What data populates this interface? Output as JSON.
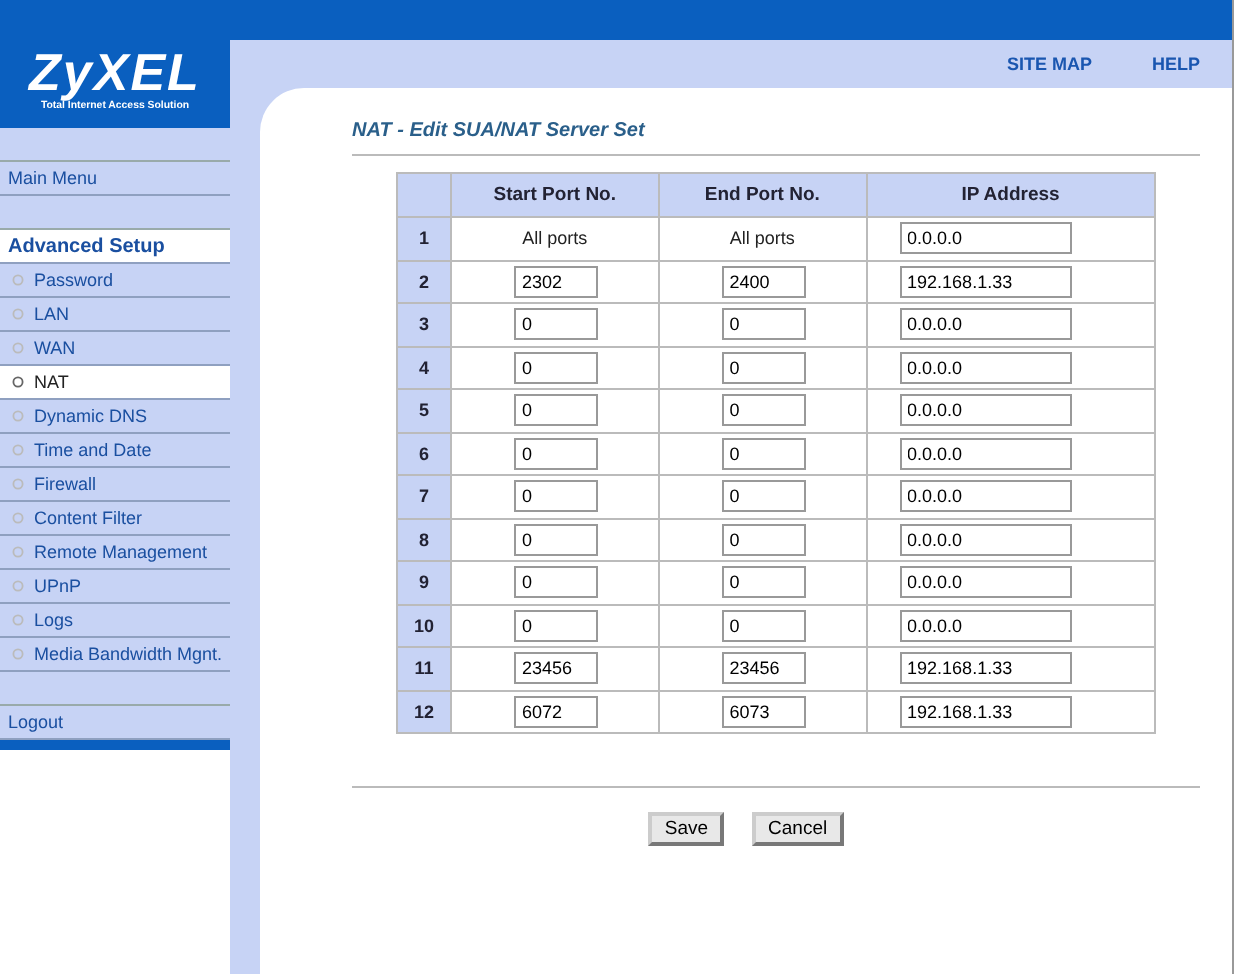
{
  "logo": {
    "name": "ZyXEL",
    "tagline": "Total Internet Access Solution"
  },
  "header_links": [
    "SITE MAP",
    "HELP"
  ],
  "sidebar": {
    "main_menu": "Main Menu",
    "section_title": "Advanced Setup",
    "items": [
      {
        "label": "Password",
        "selected": false
      },
      {
        "label": "LAN",
        "selected": false
      },
      {
        "label": "WAN",
        "selected": false
      },
      {
        "label": "NAT",
        "selected": true
      },
      {
        "label": "Dynamic DNS",
        "selected": false
      },
      {
        "label": "Time and Date",
        "selected": false
      },
      {
        "label": "Firewall",
        "selected": false
      },
      {
        "label": "Content Filter",
        "selected": false
      },
      {
        "label": "Remote Management",
        "selected": false
      },
      {
        "label": "UPnP",
        "selected": false
      },
      {
        "label": "Logs",
        "selected": false
      },
      {
        "label": "Media Bandwidth Mgnt.",
        "selected": false
      }
    ],
    "logout": "Logout"
  },
  "page_title": "NAT - Edit SUA/NAT Server Set",
  "table": {
    "columns": [
      "Start Port No.",
      "End Port No.",
      "IP Address"
    ],
    "rows": [
      {
        "number": "1",
        "kind": "fixed",
        "start": "All ports",
        "end": "All ports",
        "ip": "0.0.0.0"
      },
      {
        "number": "2",
        "kind": "editable",
        "start": "2302",
        "end": "2400",
        "ip": "192.168.1.33"
      },
      {
        "number": "3",
        "kind": "editable",
        "start": "0",
        "end": "0",
        "ip": "0.0.0.0"
      },
      {
        "number": "4",
        "kind": "editable",
        "start": "0",
        "end": "0",
        "ip": "0.0.0.0"
      },
      {
        "number": "5",
        "kind": "editable",
        "start": "0",
        "end": "0",
        "ip": "0.0.0.0"
      },
      {
        "number": "6",
        "kind": "editable",
        "start": "0",
        "end": "0",
        "ip": "0.0.0.0"
      },
      {
        "number": "7",
        "kind": "editable",
        "start": "0",
        "end": "0",
        "ip": "0.0.0.0"
      },
      {
        "number": "8",
        "kind": "editable",
        "start": "0",
        "end": "0",
        "ip": "0.0.0.0"
      },
      {
        "number": "9",
        "kind": "editable",
        "start": "0",
        "end": "0",
        "ip": "0.0.0.0"
      },
      {
        "number": "10",
        "kind": "editable",
        "start": "0",
        "end": "0",
        "ip": "0.0.0.0"
      },
      {
        "number": "11",
        "kind": "editable",
        "start": "23456",
        "end": "23456",
        "ip": "192.168.1.33"
      },
      {
        "number": "12",
        "kind": "editable",
        "start": "6072",
        "end": "6073",
        "ip": "192.168.1.33"
      }
    ]
  },
  "buttons": [
    "Save",
    "Cancel"
  ]
}
